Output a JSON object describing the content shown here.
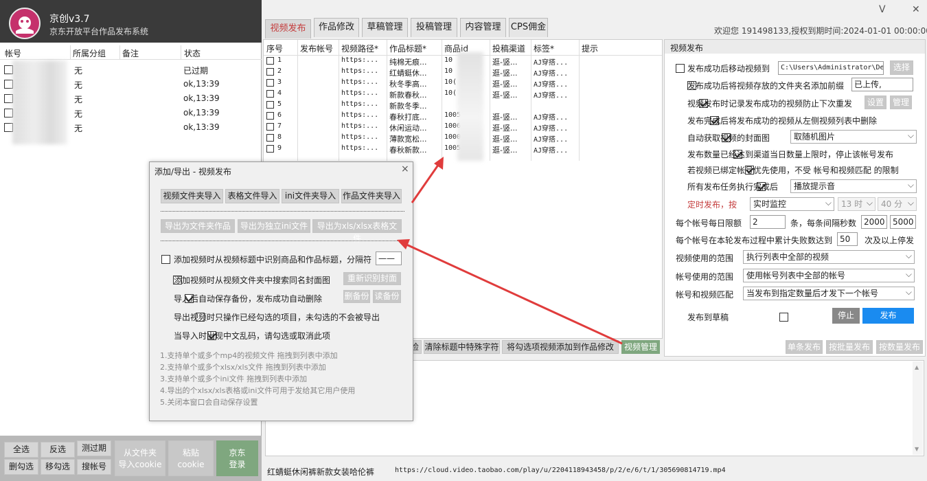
{
  "app": {
    "name": "京创v3.7",
    "subtitle": "京东开放平台作品发布系统",
    "welcome": "欢迎您 191498133,授权到期时间:2024-01-01 00:00:00"
  },
  "window_controls": {
    "min": "V",
    "close": "✕"
  },
  "tabs": [
    "视频发布",
    "作品修改",
    "草稿管理",
    "投稿管理",
    "内容管理",
    "CPS佣金"
  ],
  "accounts": {
    "headers": [
      "帐号",
      "所属分组",
      "备注",
      "状态"
    ],
    "rows": [
      {
        "group": "无",
        "note": "",
        "status": "已过期"
      },
      {
        "group": "无",
        "note": "",
        "status": "ok,13:39"
      },
      {
        "group": "无",
        "note": "",
        "status": "ok,13:39"
      },
      {
        "group": "无",
        "note": "",
        "status": "ok,13:39"
      },
      {
        "group": "无",
        "note": "",
        "status": "ok,13:39"
      }
    ],
    "buttons": {
      "select_all": "全选",
      "invert": "反选",
      "test_expired": "测过期",
      "delete_checked": "删勾选",
      "move_checked": "移勾选",
      "search_account": "搜帐号",
      "import_cookie": "从文件夹\n导入cookie",
      "paste_cookie": "粘贴\ncookie",
      "jd_login": "京东\n登录"
    }
  },
  "videos": {
    "headers": [
      "序号",
      "发布帐号",
      "视频路径*",
      "作品标题*",
      "商品id",
      "投稿渠道",
      "标签*",
      "提示"
    ],
    "rows": [
      {
        "n": "1",
        "path": "https:...",
        "title": "纯棉无痕...",
        "id": "10",
        "channel": "逛-竖...",
        "tag": "AJ穿搭..."
      },
      {
        "n": "2",
        "path": "https:...",
        "title": "红蜻蜓休...",
        "id": "10",
        "channel": "逛-竖...",
        "tag": "AJ穿搭..."
      },
      {
        "n": "3",
        "path": "https:...",
        "title": "秋冬季高...",
        "id": "10(",
        "channel": "逛-竖...",
        "tag": "AJ穿搭..."
      },
      {
        "n": "4",
        "path": "https:...",
        "title": "新款春秋...",
        "id": "10(",
        "channel": "逛-竖...",
        "tag": "AJ穿搭..."
      },
      {
        "n": "5",
        "path": "https:...",
        "title": "新款冬季...",
        "id": "",
        "channel": "",
        "tag": ""
      },
      {
        "n": "6",
        "path": "https:...",
        "title": "春秋打底...",
        "id": "1005",
        "channel": "逛-竖...",
        "tag": "AJ穿搭..."
      },
      {
        "n": "7",
        "path": "https:...",
        "title": "休闲运动...",
        "id": "1006",
        "channel": "逛-竖...",
        "tag": "AJ穿搭..."
      },
      {
        "n": "8",
        "path": "https:...",
        "title": "薄款宽松...",
        "id": "1000",
        "channel": "逛-竖...",
        "tag": "AJ穿搭..."
      },
      {
        "n": "9",
        "path": "https:...",
        "title": "春秋新款...",
        "id": "1005",
        "channel": "逛-竖...",
        "tag": "AJ穿搭..."
      }
    ],
    "bottom_buttons": {
      "check": "检",
      "clear_special": "清除标题中特殊字符",
      "add_to_edit": "将勾选项视频添加到作品修改",
      "video_manage": "视频管理"
    }
  },
  "settings": {
    "title": "视频发布",
    "move_after": "发布成功后移动视频到",
    "move_path": "C:\\Users\\Administrator\\De",
    "choose": "选择",
    "add_prefix": "发布成功后将视频存放的文件夹名添加前缀",
    "prefix_value": "已上传,",
    "record_success": "视频发布时记录发布成功的视频防止下次重发",
    "setup": "设置",
    "manage": "管理",
    "delete_after": "发布完成后将发布成功的视频从左侧视频列表中删除",
    "auto_cover": "自动获取视频的封面图",
    "cover_option": "取随机图片",
    "stop_limit": "发布数量已经达到渠道当日数量上限时，停止该帐号发布",
    "bind_priority": "若视频已绑定帐号优先使用，不受 帐号和视频匹配 的限制",
    "all_done": "所有发布任务执行完成后",
    "done_option": "播放提示音",
    "timed": "定时发布，按",
    "timed_mode": "实时监控",
    "hour": "13 时",
    "minute": "40 分",
    "daily_limit_label": "每个帐号每日限额",
    "daily_limit": "2",
    "interval_label": "条，每条间隔秒数",
    "interval_min": "2000",
    "interval_max": "5000",
    "fail_label": "每个帐号在本轮发布过程中累计失败数达到",
    "fail_count": "50",
    "fail_suffix": "次及以上停发",
    "video_range_label": "视频使用的范围",
    "video_range": "执行列表中全部的视频",
    "account_range_label": "帐号使用的范围",
    "account_range": "使用帐号列表中全部的帐号",
    "match_label": "帐号和视频匹配",
    "match_option": "当发布到指定数量后才发下一个帐号",
    "to_draft": "发布到草稿",
    "stop": "停止",
    "publish": "发布",
    "single": "单条发布",
    "batch_by": "按批量发布",
    "by_count": "按数量发布"
  },
  "status_bar": {
    "title": "红蜻蜓休闲裤新款女装哈伦裤",
    "url": "https://cloud.video.taobao.com/play/u/2204118943458/p/2/e/6/t/1/305690814719.mp4"
  },
  "dialog": {
    "title": "添加/导出 - 视频发布",
    "close": "×",
    "import_buttons": [
      "视频文件夹导入",
      "表格文件导入",
      "ini文件夹导入",
      "作品文件夹导入"
    ],
    "export_buttons": [
      "导出为文件夹作品",
      "导出为独立ini文件",
      "导出为xls/xlsx表格文件"
    ],
    "opt_identify": "添加视频时从视频标题中识别商品和作品标题，分隔符",
    "separator": "——",
    "opt_cover": "添加视频时从视频文件夹中搜索同名封面图",
    "re_identify": "重新识别封面",
    "opt_backup": "导入后自动保存备份，发布成功自动删除",
    "del_backup": "删备份",
    "read_backup": "读备份",
    "opt_export_checked": "导出视频时只操作已经勾选的项目，未勾选的不会被导出",
    "opt_encoding": "当导入时出现中文乱码，请勾选或取消此项",
    "notes": [
      "1.支持单个或多个mp4的视频文件 拖拽到列表中添加",
      "2.支持单个或多个xlsx/xls文件 拖拽到列表中添加",
      "3.支持单个或多个ini文件 拖拽到列表中添加",
      "4.导出的个xlsx/xls表格或ini文件可用于发给其它用户使用",
      "5.关闭本窗口会自动保存设置"
    ]
  },
  "colors": {
    "accent": "#c43c3c",
    "header_bg": "#3a3a3a",
    "publish": "#1a8bf0",
    "green_btn": "#7fa77f"
  }
}
